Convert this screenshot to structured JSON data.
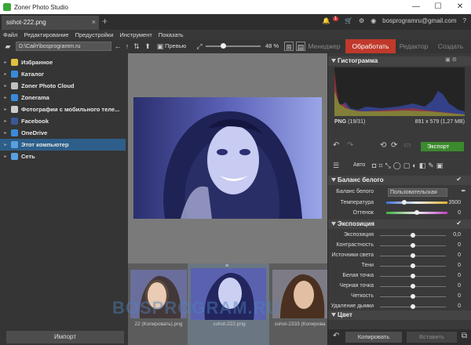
{
  "window": {
    "title": "Zoner Photo Studio"
  },
  "tab": {
    "label": "sshot-222.png",
    "close": "×",
    "plus": "+"
  },
  "topright": {
    "badge": "1",
    "account": "bosprogramru@gmail.com"
  },
  "menu": [
    "Файл",
    "Редактирование",
    "Предустройки",
    "Инструмент",
    "Показать"
  ],
  "toolbar": {
    "path": "D:\\Cайт\\bosprogramm.ru",
    "preview_label": "Превью",
    "zoom": "48 %",
    "zoom_fraction": 0.32
  },
  "modes": [
    "Менеджер",
    "Обработать",
    "Редактор",
    "Создать"
  ],
  "active_mode_index": 1,
  "nav": [
    {
      "label": "Избранное",
      "color": "#e0c040",
      "selected": false
    },
    {
      "label": "Каталог",
      "color": "#3a8ad8",
      "selected": false
    },
    {
      "label": "Zoner Photo Cloud",
      "color": "#c0c0c0",
      "selected": false
    },
    {
      "label": "Zonerama",
      "color": "#3a8ad8",
      "selected": false
    },
    {
      "label": "Фотографии с мобильного теле...",
      "color": "#cccccc",
      "selected": false
    },
    {
      "label": "Facebook",
      "color": "#3b5998",
      "selected": false
    },
    {
      "label": "OneDrive",
      "color": "#3a8ad8",
      "selected": false
    },
    {
      "label": "Этот компьютер",
      "color": "#5aa0e0",
      "selected": true
    },
    {
      "label": "Сеть",
      "color": "#5aa0e0",
      "selected": false
    }
  ],
  "import_label": "Импорт",
  "thumbnails": [
    {
      "label": "22 (Копировать).png"
    },
    {
      "label": "sshot-222.png"
    },
    {
      "label": "sshot-2333 (Копирова"
    }
  ],
  "histogram": {
    "title": "Гистограмма",
    "format": "PNG",
    "fraction": "(19/31)",
    "dims": "891 x 579 (1,27 MB)"
  },
  "export_label": "Экспорт",
  "auto_label": "Авто",
  "white_balance": {
    "title": "Баланс белого",
    "wb_label": "Баланс белого",
    "wb_value": "Пользовательская",
    "temp_label": "Температура",
    "temp_value": "3500",
    "temp_level": 0.3,
    "tint_label": "Оттенок",
    "tint_value": "0",
    "tint_level": 0.5
  },
  "exposure": {
    "title": "Экспозиция",
    "rows": [
      {
        "label": "Экспозиция",
        "value": "0,0",
        "level": 0.5
      },
      {
        "label": "Контрастность",
        "value": "0",
        "level": 0.5
      },
      {
        "label": "Источники света",
        "value": "0",
        "level": 0.5
      },
      {
        "label": "Тени",
        "value": "0",
        "level": 0.5
      },
      {
        "label": "Белая точка",
        "value": "0",
        "level": 0.5
      },
      {
        "label": "Черная точка",
        "value": "0",
        "level": 0.5
      },
      {
        "label": "Четкость",
        "value": "0",
        "level": 0.5
      },
      {
        "label": "Удаление дымки",
        "value": "0",
        "level": 0.5
      }
    ]
  },
  "color_section": {
    "title": "Цвет"
  },
  "copy_label": "Копировать",
  "paste_label": "Вставить",
  "watermark": "BOSPROGRAM.RU",
  "colors": {
    "accent": "#c0392b",
    "export": "#3c8a2e",
    "selected": "#2d5f8a"
  }
}
